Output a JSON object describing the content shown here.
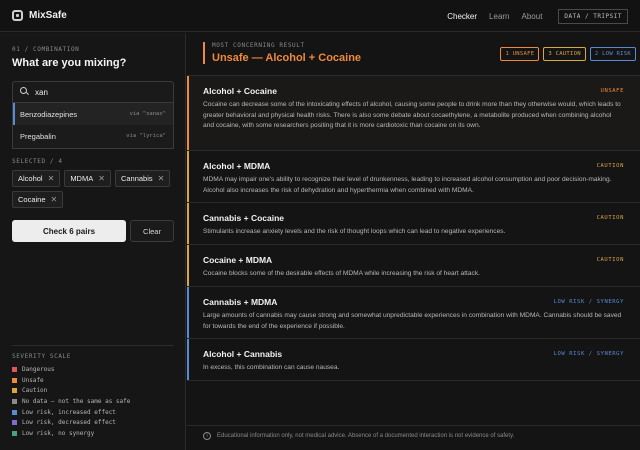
{
  "app": {
    "name": "MixSafe"
  },
  "nav": {
    "checker": "Checker",
    "learn": "Learn",
    "about": "About",
    "data_btn": "DATA / TRIPSIT"
  },
  "left": {
    "step": "01 / COMBINATION",
    "question": "What are you mixing?",
    "search": {
      "value": "xan",
      "placeholder": ""
    },
    "dropdown": [
      {
        "name": "Benzodiazepines",
        "via": "via \"xanax\""
      },
      {
        "name": "Pregabalin",
        "via": "via \"lyrica\""
      }
    ],
    "selected_label": "SELECTED / 4",
    "chips": [
      "Alcohol",
      "MDMA",
      "Cannabis",
      "Cocaine"
    ],
    "check_button": "Check 6 pairs",
    "clear_button": "Clear",
    "legend_title": "SEVERITY SCALE",
    "legend": [
      {
        "label": "Dangerous",
        "color": "#e05555"
      },
      {
        "label": "Unsafe",
        "color": "#ef8a3c"
      },
      {
        "label": "Caution",
        "color": "#d9a640"
      },
      {
        "label": "No data — not the same as safe",
        "color": "#8a8a8a"
      },
      {
        "label": "Low risk, increased effect",
        "color": "#5a8ad6"
      },
      {
        "label": "Low risk, decreased effect",
        "color": "#7a6cd0"
      },
      {
        "label": "Low risk, no synergy",
        "color": "#4aa37a"
      }
    ]
  },
  "result": {
    "kicker": "MOST CONCERNING RESULT",
    "title": "Unsafe — Alcohol + Cocaine",
    "badges": [
      {
        "label": "1 UNSAFE",
        "color": "#ef8a3c"
      },
      {
        "label": "3 CAUTION",
        "color": "#d9a640"
      },
      {
        "label": "2 LOW RISK",
        "color": "#5a8ad6"
      }
    ],
    "pairs": [
      {
        "name": "Alcohol + Cocaine",
        "severity": "UNSAFE",
        "color": "#ef8a3c",
        "desc": "Cocaine can decrease some of the intoxicating effects of alcohol, causing some people to drink more than they otherwise would, which leads to greater behavioral and physical health risks. There is also some debate about cocaethylene, a metabolite produced when combining alcohol and cocaine, with some researchers positing that it is more cardiotoxic than cocaine on its own."
      },
      {
        "name": "Alcohol + MDMA",
        "severity": "CAUTION",
        "color": "#d9a640",
        "desc": "MDMA may impair one's ability to recognize their level of drunkenness, leading to increased alcohol consumption and poor decision-making. Alcohol also increases the risk of dehydration and hyperthermia when combined with MDMA."
      },
      {
        "name": "Cannabis + Cocaine",
        "severity": "CAUTION",
        "color": "#d9a640",
        "desc": "Stimulants increase anxiety levels and the risk of thought loops which can lead to negative experiences."
      },
      {
        "name": "Cocaine + MDMA",
        "severity": "CAUTION",
        "color": "#d9a640",
        "desc": "Cocaine blocks some of the desirable effects of MDMA while increasing the risk of heart attack."
      },
      {
        "name": "Cannabis + MDMA",
        "severity": "LOW RISK / SYNERGY",
        "color": "#5a8ad6",
        "desc": "Large amounts of cannabis may cause strong and somewhat unpredictable experiences in combination with MDMA. Cannabis should be saved for towards the end of the experience if possible."
      },
      {
        "name": "Alcohol + Cannabis",
        "severity": "LOW RISK / SYNERGY",
        "color": "#5a8ad6",
        "desc": "In excess, this combination can cause nausea."
      }
    ],
    "footer": "Educational information only, not medical advice. Absence of a documented interaction is not evidence of safety."
  }
}
